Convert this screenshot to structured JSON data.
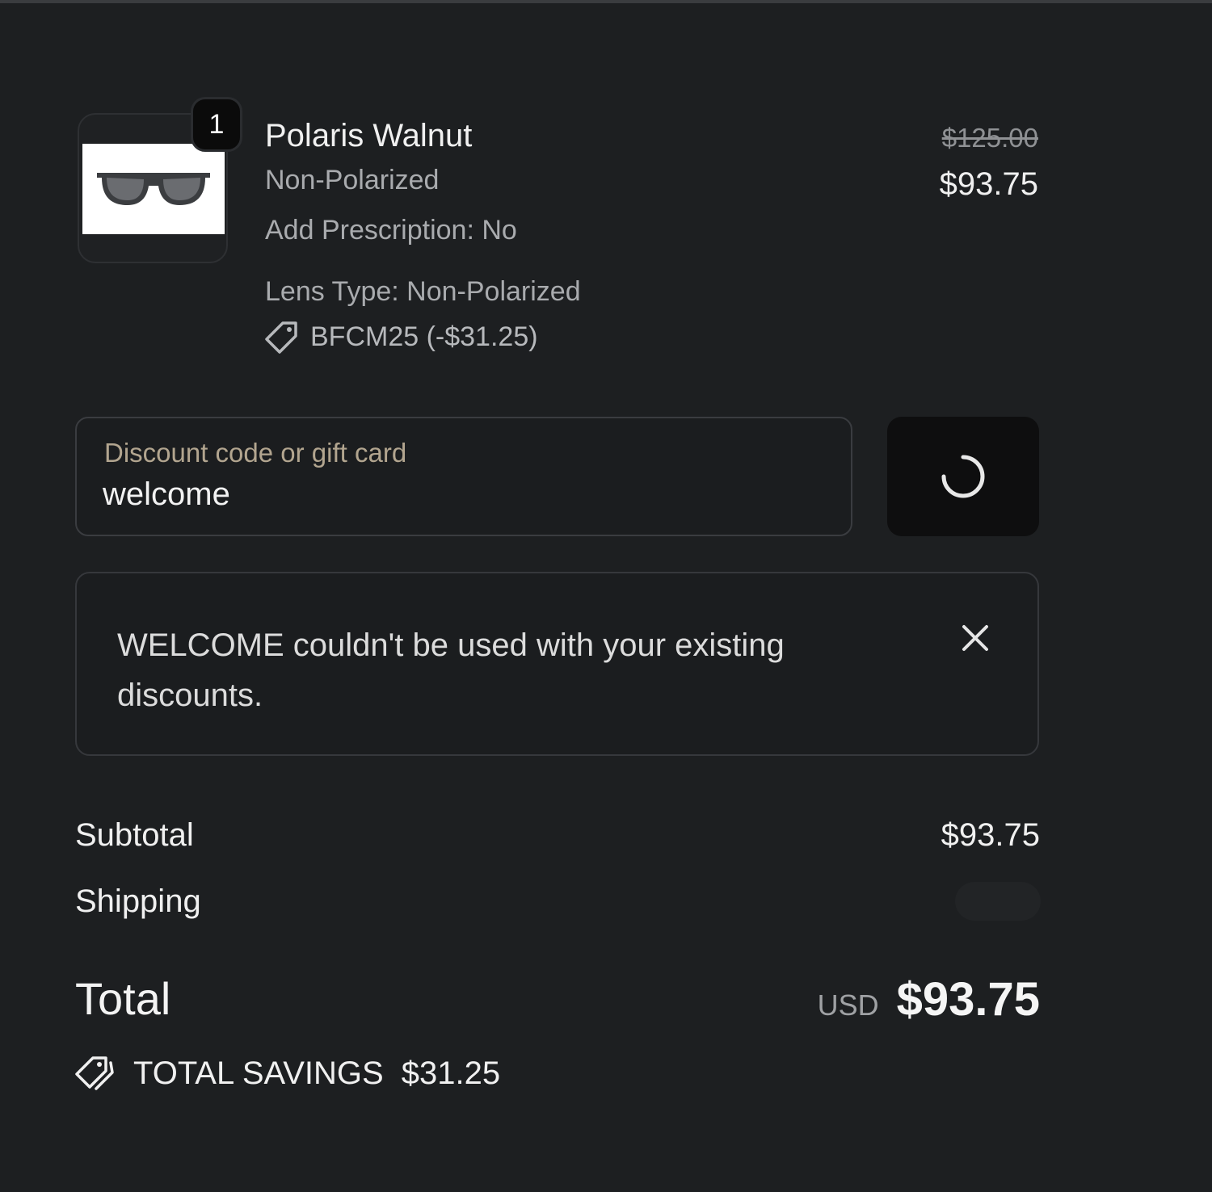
{
  "cart": {
    "item": {
      "quantity": "1",
      "name": "Polaris Walnut",
      "variant": "Non-Polarized",
      "prescription": "Add Prescription: No",
      "lens_type": "Lens Type: Non-Polarized",
      "discount": "BFCM25 (-$31.25)",
      "original_price": "$125.00",
      "price": "$93.75",
      "image_icon": "sunglasses-icon"
    },
    "discount_field": {
      "label": "Discount code or gift card",
      "value": "welcome"
    },
    "apply_button": {
      "icon": "spinner-icon"
    },
    "notice": {
      "message": "WELCOME couldn't be used with your existing discounts.",
      "close_icon": "close-icon"
    },
    "summary": {
      "subtotal_label": "Subtotal",
      "subtotal_value": "$93.75",
      "shipping_label": "Shipping",
      "total_label": "Total",
      "currency": "USD",
      "total_value": "$93.75",
      "savings_label": "TOTAL SAVINGS",
      "savings_value": "$31.25"
    }
  },
  "colors": {
    "background": "#1d1f21",
    "field_label": "#b2a58f",
    "muted_text": "#a9abae"
  }
}
